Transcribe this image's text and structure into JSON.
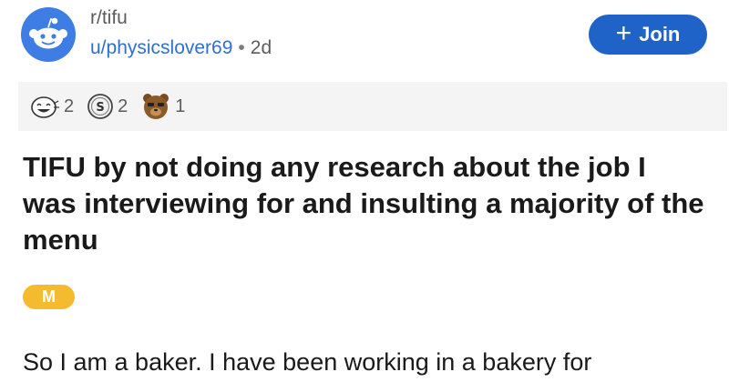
{
  "post": {
    "subreddit": "r/tifu",
    "author": "u/physicslover69",
    "separator": "•",
    "age": "2d",
    "join_label": "Join",
    "awards": [
      {
        "icon": "laughing-face-icon",
        "count": "2"
      },
      {
        "icon": "silver-coin-icon",
        "count": "2"
      },
      {
        "icon": "bear-award-icon",
        "count": "1"
      }
    ],
    "title": "TIFU by not doing any research about the job I was interviewing for and insulting a majority of the menu",
    "flair": "M",
    "body": "So I am a baker. I have been working in a bakery for"
  },
  "colors": {
    "avatar_bg": "#3d7de4",
    "join_bg": "#1f63c9",
    "username": "#2f6fd4",
    "flair_bg": "#f4bb2e",
    "award_strip_bg": "#f4f4f4"
  }
}
